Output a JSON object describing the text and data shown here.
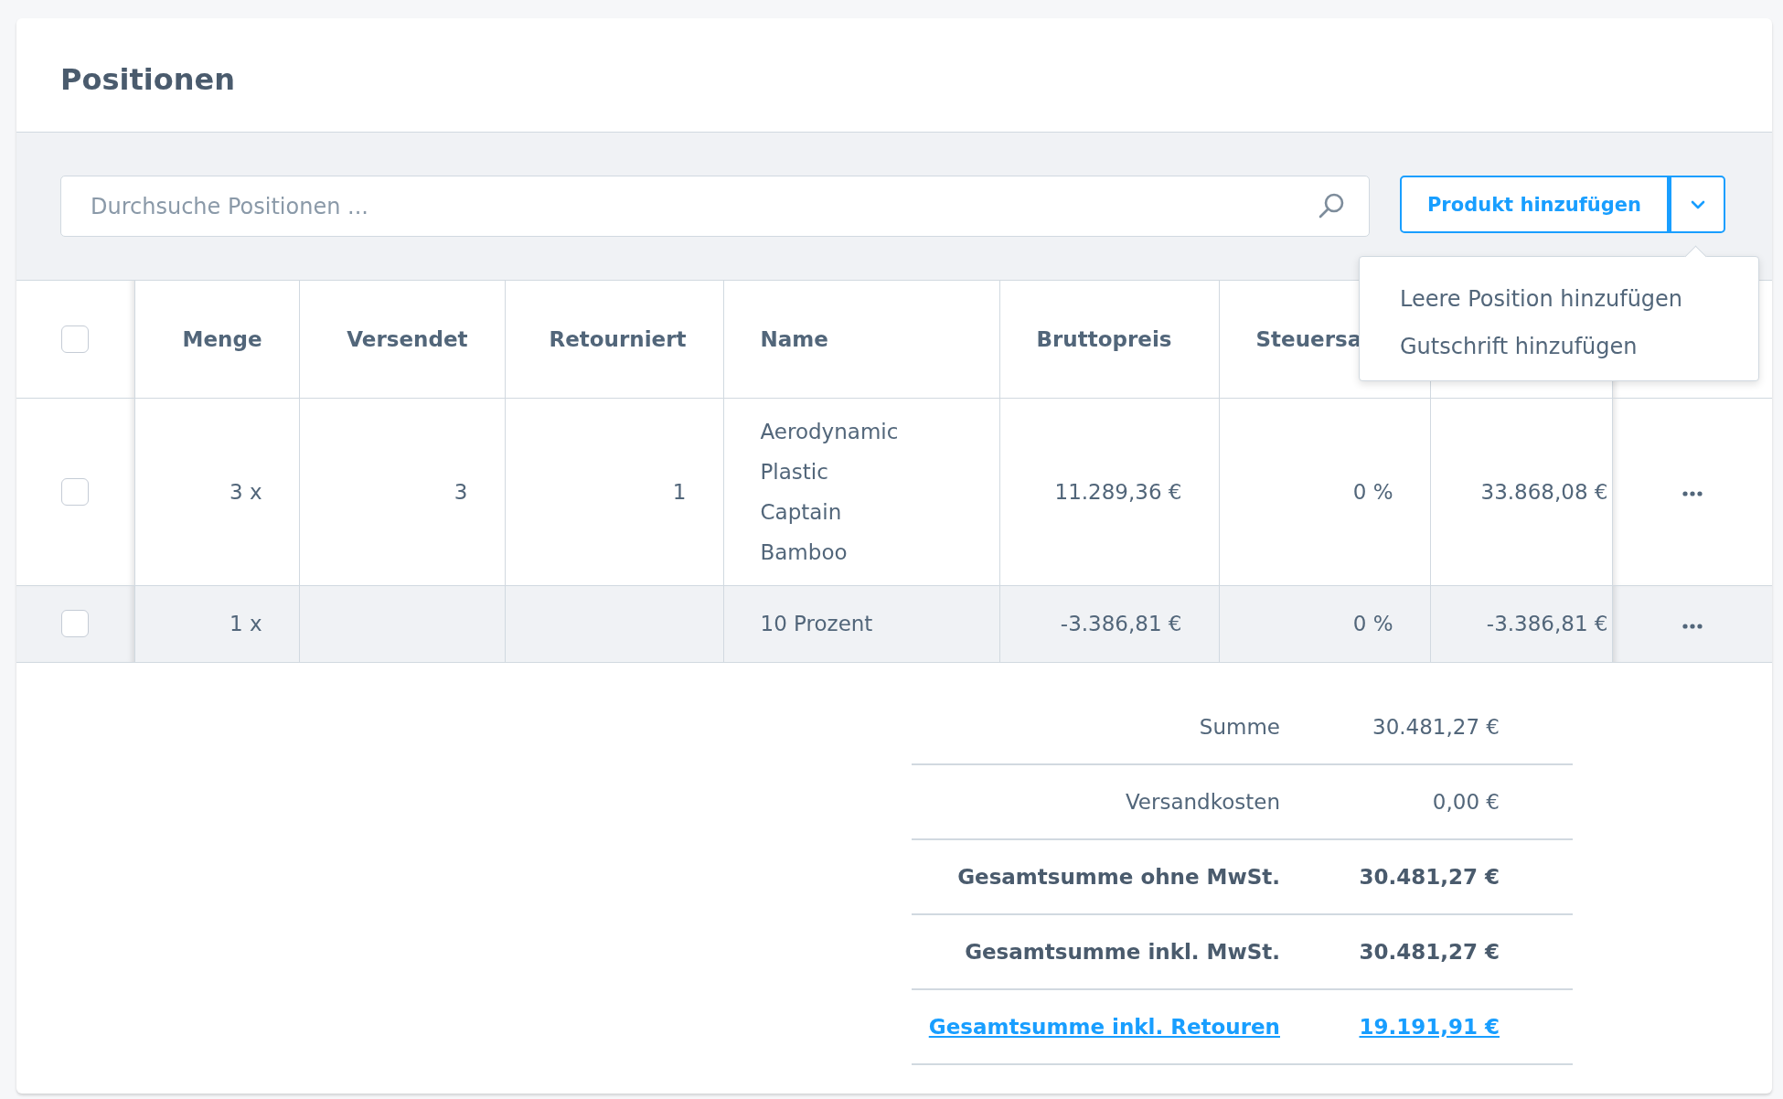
{
  "card": {
    "title": "Positionen"
  },
  "search": {
    "placeholder": "Durchsuche Positionen ..."
  },
  "add_button": {
    "label": "Produkt hinzufügen"
  },
  "add_menu": {
    "expanded": true,
    "items": [
      "Leere Position hinzufügen",
      "Gutschrift hinzufügen"
    ]
  },
  "table": {
    "select_all": {
      "checked": false
    },
    "columns": [
      "Menge",
      "Versendet",
      "Retourniert",
      "Name",
      "Bruttopreis",
      "Steuersa"
    ],
    "rows": [
      {
        "checked": false,
        "hovered": false,
        "cells": [
          "3 x",
          "3",
          "1",
          "Aerodynamic Plastic Captain Bamboo",
          "11.289,36 €",
          "0 %",
          "33.868,08 €"
        ]
      },
      {
        "checked": false,
        "hovered": true,
        "cells": [
          "1 x",
          "",
          "",
          "10 Prozent",
          "-3.386,81 €",
          "0 %",
          "-3.386,81 €"
        ]
      }
    ]
  },
  "totals": [
    {
      "kind": "plain",
      "label": "Summe",
      "value": "30.481,27 €"
    },
    {
      "kind": "plain",
      "label": "Versandkosten",
      "value": "0,00 €"
    },
    {
      "kind": "bold",
      "label": "Gesamtsumme ohne MwSt.",
      "value": "30.481,27 €"
    },
    {
      "kind": "bold",
      "label": "Gesamtsumme inkl. MwSt.",
      "value": "30.481,27 €"
    },
    {
      "kind": "link",
      "label": "Gesamtsumme inkl. Retouren",
      "value": "19.191,91 €"
    }
  ]
}
